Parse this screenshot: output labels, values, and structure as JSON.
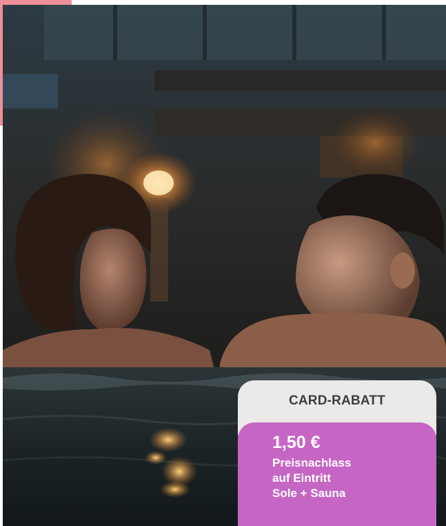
{
  "photo": {
    "subject": "couple-in-thermal-pool-at-dusk"
  },
  "card": {
    "header": "CARD-RABATT",
    "price": "1,50 €",
    "lines": [
      "Preisnachlass",
      "auf Eintritt",
      "Sole + Sauna"
    ]
  },
  "colors": {
    "accent_pink": "#ef8f97",
    "card_header_bg": "#ebeae8",
    "card_body_bg": "#c666c4",
    "card_header_text": "#3d3d3d",
    "card_body_text": "#ffffff"
  }
}
